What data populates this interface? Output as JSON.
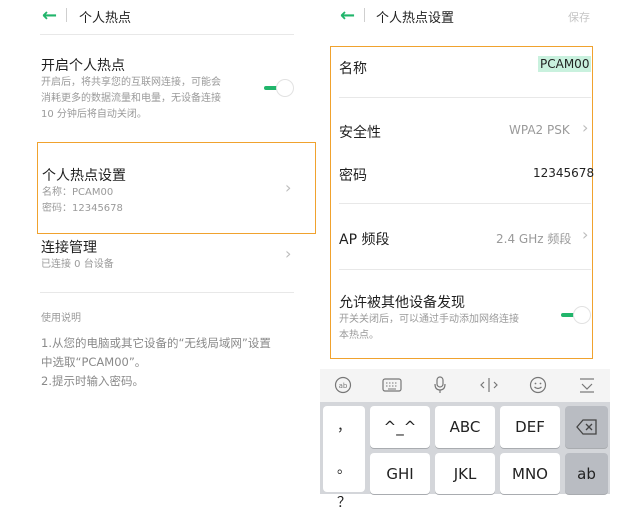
{
  "left": {
    "header": {
      "title": "个人热点"
    },
    "hotspot_toggle": {
      "title": "开启个人热点",
      "desc_lines": [
        "开启后，将共享您的互联网连接，可能会",
        "消耗更多的数据流量和电量，无设备连接",
        "10 分钟后将自动关闭。"
      ],
      "on": true
    },
    "hotspot_settings": {
      "title": "个人热点设置",
      "name_line": "名称：PCAM00",
      "password_line": "密码：12345678"
    },
    "connection_mgmt": {
      "title": "连接管理",
      "sub": "已连接 0 台设备"
    },
    "instructions": {
      "heading": "使用说明",
      "lines": [
        "1.从您的电脑或其它设备的“无线局域网”设置",
        "中选取“PCAM00”。",
        "2.提示时输入密码。"
      ]
    }
  },
  "right": {
    "header": {
      "title": "个人热点设置",
      "save": "保存"
    },
    "rows": {
      "name_label": "名称",
      "name_value": "PCAM00",
      "security_label": "安全性",
      "security_value": "WPA2 PSK",
      "password_label": "密码",
      "password_value": "12345678",
      "band_label": "AP 频段",
      "band_value": "2.4 GHz 频段",
      "discover_label": "允许被其他设备发现",
      "discover_desc_lines": [
        "开关关闭后，可以通过手动添加网络连接",
        "本热点。"
      ],
      "discover_on": true
    },
    "keyboard": {
      "toolbar_icons": [
        "emoji-mode-icon",
        "keyboard-icon",
        "microphone-icon",
        "cursor-icon",
        "smiley-icon",
        "collapse-keyboard-icon"
      ],
      "keys": {
        "comma": "，",
        "period": "。",
        "question": "？",
        "face": "^_^",
        "abc": "ABC",
        "def": "DEF",
        "ghi": "GHI",
        "jkl": "JKL",
        "mno": "MNO",
        "ab": "ab"
      }
    }
  },
  "colors": {
    "accent": "#21b56b",
    "highlight": "#f0a22e",
    "selection": "#c9f1de"
  }
}
